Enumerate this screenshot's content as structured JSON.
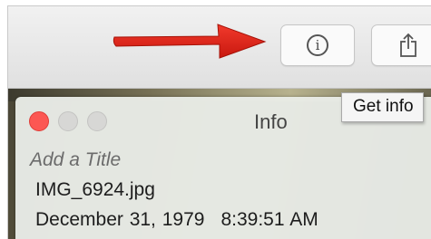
{
  "toolbar": {
    "info_icon_glyph": "i",
    "share_icon": "share-icon"
  },
  "tooltip": {
    "text": "Get info"
  },
  "info_panel": {
    "title": "Info",
    "title_placeholder": "Add a Title",
    "filename": "IMG_6924.jpg",
    "date": "December 31, 1979",
    "time": "8:39:51 AM"
  },
  "colors": {
    "annotation_arrow": "#e0271b",
    "close_button": "#fc5753",
    "inactive_button": "#d7d7d5"
  }
}
